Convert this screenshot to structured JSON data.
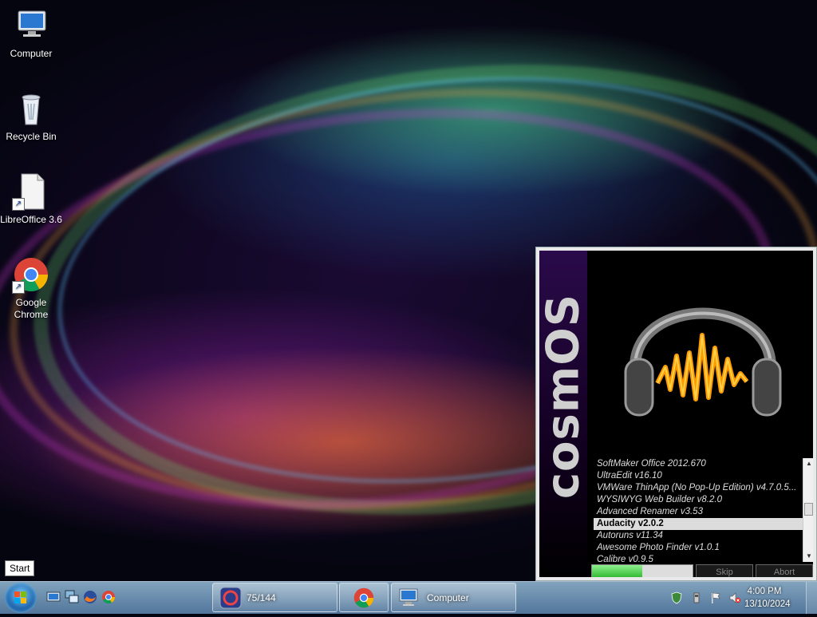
{
  "desktop": {
    "icons": [
      {
        "label": "Computer"
      },
      {
        "label": "Recycle Bin"
      },
      {
        "label": "LibreOffice 3.6"
      },
      {
        "label": "Google Chrome"
      }
    ]
  },
  "tooltip": {
    "text": "Start"
  },
  "splash": {
    "brand": "cosmOS",
    "programs": [
      "SoftMaker Office 2012.670",
      "UltraEdit v16.10",
      "VMWare ThinApp (No Pop-Up Edition) v4.7.0.5...",
      "WYSIWYG Web Builder v8.2.0",
      "Advanced Renamer v3.53",
      "Audacity v2.0.2",
      "Autoruns v11.34",
      "Awesome Photo Finder v1.0.1",
      "Calibre v0.9.5"
    ],
    "selected_index": 5,
    "progress_fraction": 0.5,
    "buttons": {
      "skip": "Skip",
      "abort": "Abort"
    }
  },
  "taskbar": {
    "tasks": [
      {
        "label": "75/144"
      },
      {
        "label": ""
      },
      {
        "label": "Computer"
      }
    ],
    "clock": {
      "time": "4:00 PM",
      "date": "13/10/2024"
    }
  },
  "colors": {
    "accent": "#22b022",
    "selection": "#dcdcdc",
    "taskbar": "#5a82aa"
  }
}
